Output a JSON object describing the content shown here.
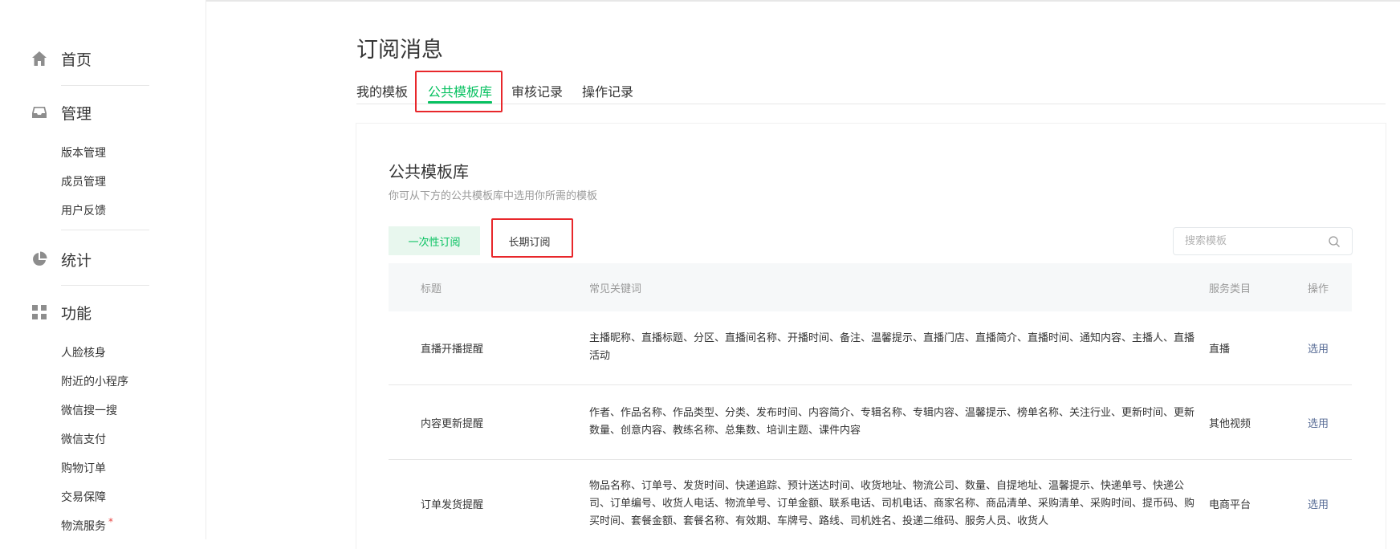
{
  "sidebar": {
    "home": {
      "label": "首页",
      "icon": "home-icon"
    },
    "manage": {
      "label": "管理",
      "icon": "inbox-icon",
      "items": [
        "版本管理",
        "成员管理",
        "用户反馈"
      ]
    },
    "stats": {
      "label": "统计",
      "icon": "pie-chart-icon"
    },
    "features": {
      "label": "功能",
      "icon": "grid-icon",
      "items": [
        "人脸核身",
        "附近的小程序",
        "微信搜一搜",
        "微信支付",
        "购物订单",
        "交易保障",
        "物流服务"
      ],
      "badge": "*"
    }
  },
  "main": {
    "title": "订阅消息",
    "tabs": [
      {
        "label": "我的模板",
        "active": false
      },
      {
        "label": "公共模板库",
        "active": true
      },
      {
        "label": "审核记录",
        "active": false
      },
      {
        "label": "操作记录",
        "active": false
      }
    ],
    "card": {
      "title": "公共模板库",
      "desc": "你可从下方的公共模板库中选用你所需的模板",
      "type_buttons": [
        "一次性订阅",
        "长期订阅"
      ],
      "search_placeholder": "搜索模板",
      "table": {
        "headers": [
          "标题",
          "常见关键词",
          "服务类目",
          "操作"
        ],
        "rows": [
          {
            "title": "直播开播提醒",
            "keywords": "主播昵称、直播标题、分区、直播间名称、开播时间、备注、温馨提示、直播门店、直播简介、直播时间、通知内容、主播人、直播活动",
            "category": "直播",
            "action": "选用"
          },
          {
            "title": "内容更新提醒",
            "keywords": "作者、作品名称、作品类型、分类、发布时间、内容简介、专辑名称、专辑内容、温馨提示、榜单名称、关注行业、更新时间、更新数量、创意内容、教练名称、总集数、培训主题、课件内容",
            "category": "其他视频",
            "action": "选用"
          },
          {
            "title": "订单发货提醒",
            "keywords": "物品名称、订单号、发货时间、快递追踪、预计送达时间、收货地址、物流公司、数量、自提地址、温馨提示、快递单号、快递公司、订单编号、收货人电话、物流单号、订单金额、联系电话、司机电话、商家名称、商品清单、采购清单、采购时间、提币码、购买时间、套餐金额、套餐名称、有效期、车牌号、路线、司机姓名、投递二维码、服务人员、收货人",
            "category": "电商平台",
            "action": "选用"
          }
        ]
      }
    }
  }
}
